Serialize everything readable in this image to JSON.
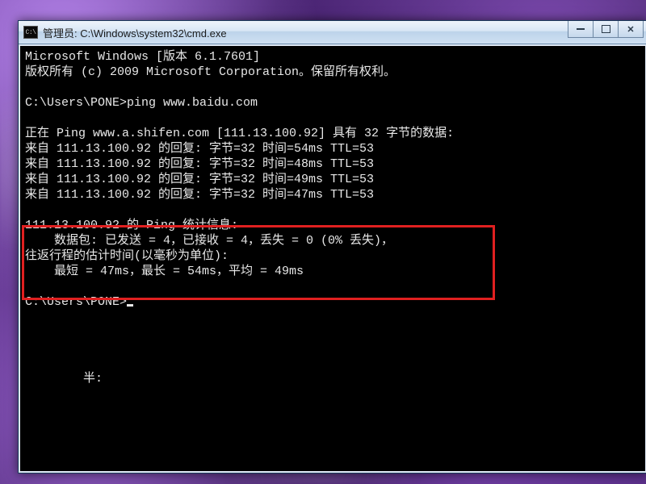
{
  "window": {
    "title": "管理员: C:\\Windows\\system32\\cmd.exe",
    "icon_label": "C:\\"
  },
  "terminal": {
    "lines": {
      "l0": "Microsoft Windows [版本 6.1.7601]",
      "l1": "版权所有 (c) 2009 Microsoft Corporation。保留所有权利。",
      "l2": "",
      "l3": "C:\\Users\\PONE>ping www.baidu.com",
      "l4": "",
      "l5": "正在 Ping www.a.shifen.com [111.13.100.92] 具有 32 字节的数据:",
      "l6": "来自 111.13.100.92 的回复: 字节=32 时间=54ms TTL=53",
      "l7": "来自 111.13.100.92 的回复: 字节=32 时间=48ms TTL=53",
      "l8": "来自 111.13.100.92 的回复: 字节=32 时间=49ms TTL=53",
      "l9": "来自 111.13.100.92 的回复: 字节=32 时间=47ms TTL=53",
      "l10": "",
      "l11": "111.13.100.92 的 Ping 统计信息:",
      "l12": "    数据包: 已发送 = 4，已接收 = 4，丢失 = 0 (0% 丢失)，",
      "l13": "往返行程的估计时间(以毫秒为单位):",
      "l14": "    最短 = 47ms，最长 = 54ms，平均 = 49ms",
      "l15": "",
      "l16_prompt": "C:\\Users\\PONE>",
      "stray": "        半:"
    }
  }
}
